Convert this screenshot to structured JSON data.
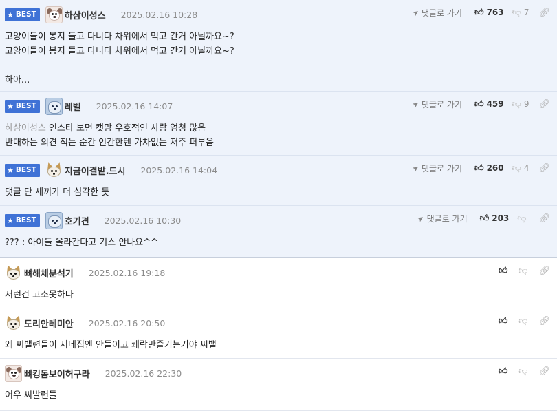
{
  "best_label": "BEST",
  "reply_link_label": "댓글로 가기",
  "comments": [
    {
      "nick": "하삼이성스",
      "date": "2025.02.16 10:28",
      "likes": "763",
      "dislikes": "7",
      "lines": [
        "고양이들이 봉지 들고 다니다 차위에서 먹고 간거 아닐까요~?",
        "고양이들이 봉지 들고 다니다 차위에서 먹고 간거 아닐까요~?",
        "",
        "하아..."
      ]
    },
    {
      "nick": "레벨",
      "date": "2025.02.16 14:07",
      "likes": "459",
      "dislikes": "9",
      "mention": "하삼이성스",
      "lines": [
        "인스타 보면 캣맘 우호적인 사람 엄청 많음",
        "반대하는 의견 적는 순간 인간한텐 가차없는 저주 퍼부음"
      ]
    },
    {
      "nick": "지금이결밭.드시",
      "date": "2025.02.16 14:04",
      "likes": "260",
      "dislikes": "4",
      "lines": [
        "댓글 단 새끼가 더 심각한 듯"
      ]
    },
    {
      "nick": "호기견",
      "date": "2025.02.16 10:30",
      "likes": "203",
      "dislikes": "",
      "lines": [
        "??? : 아이들 올라간다고 기스 안나요^^"
      ]
    },
    {
      "nick": "뼈해체분석기",
      "date": "2025.02.16 19:18",
      "lines": [
        "저런건 고소못하나"
      ]
    },
    {
      "nick": "도리안레미안",
      "date": "2025.02.16 20:50",
      "lines": [
        "왜 씨밸련들이 지네집엔 안들이고 쾌락만즐기는거야 씨밸"
      ]
    },
    {
      "nick": "뼈킹돔보이허구라",
      "date": "2025.02.16 22:30",
      "lines": [
        "어우 씨발련들"
      ]
    }
  ]
}
